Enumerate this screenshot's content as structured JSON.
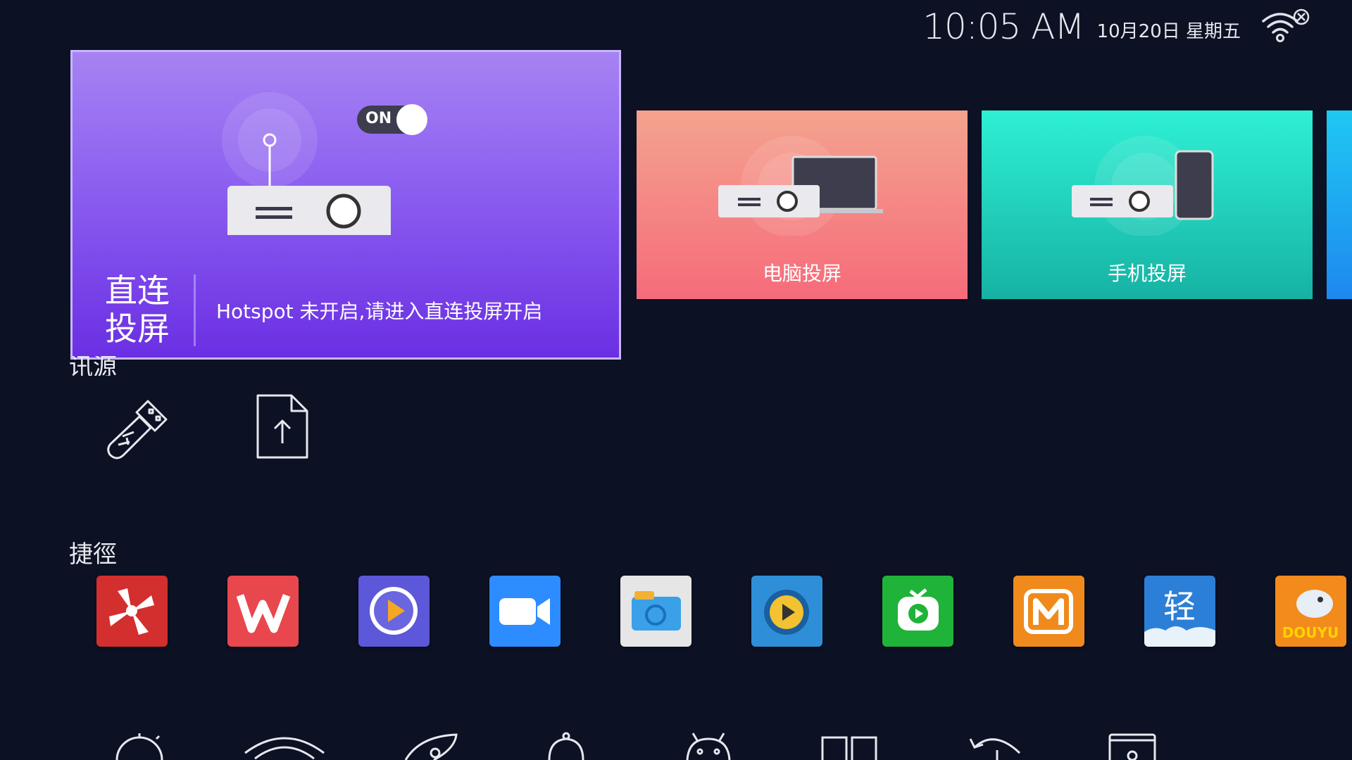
{
  "status": {
    "time": "10:05 AM",
    "date": "10月20日 星期五",
    "wifi_icon": "wifi-disconnected-icon"
  },
  "hero": {
    "toggle_label": "ON",
    "title": "直连投屏",
    "message": "Hotspot 未开启,请进入直连投屏开启",
    "colors": {
      "top": "#a683f3",
      "bottom": "#6a2fe3"
    }
  },
  "tiles": [
    {
      "label": "电脑投屏",
      "icon": "projector-laptop-icon"
    },
    {
      "label": "手机投屏",
      "icon": "projector-phone-icon"
    }
  ],
  "source": {
    "label": "讯源",
    "items": [
      {
        "icon": "usb-drive-icon"
      },
      {
        "icon": "file-upload-icon"
      }
    ]
  },
  "shortcuts": {
    "label": "捷徑",
    "apps": [
      {
        "name": "app-1",
        "icon": "pinwheel-app-icon",
        "color": "#d32f2f"
      },
      {
        "name": "app-wps",
        "icon": "wps-icon",
        "color": "#e8474d",
        "glyph": "W"
      },
      {
        "name": "app-player",
        "icon": "video-player-icon",
        "color": "#5d57d9"
      },
      {
        "name": "app-zoom",
        "icon": "video-camera-icon",
        "color": "#2d8cff"
      },
      {
        "name": "app-files",
        "icon": "folder-icon",
        "color": "#e6e6e6"
      },
      {
        "name": "app-tvplay",
        "icon": "cat-play-icon",
        "color": "#2e8fd8"
      },
      {
        "name": "app-iqiyi",
        "icon": "green-tv-icon",
        "color": "#20b339"
      },
      {
        "name": "app-mango",
        "icon": "mango-tv-icon",
        "color": "#f08a1c",
        "glyph": "M"
      },
      {
        "name": "app-qing",
        "icon": "qing-icon",
        "color": "#2c7fd6",
        "glyph": "轻"
      },
      {
        "name": "app-douyu",
        "icon": "douyu-icon",
        "color": "#f28a1c",
        "glyph": "DOUYU"
      }
    ]
  },
  "bottom_icons": [
    "timer-icon",
    "wifi-icon",
    "rocket-icon",
    "bell-icon",
    "android-icon",
    "split-screen-icon",
    "history-icon",
    "storage-icon"
  ]
}
